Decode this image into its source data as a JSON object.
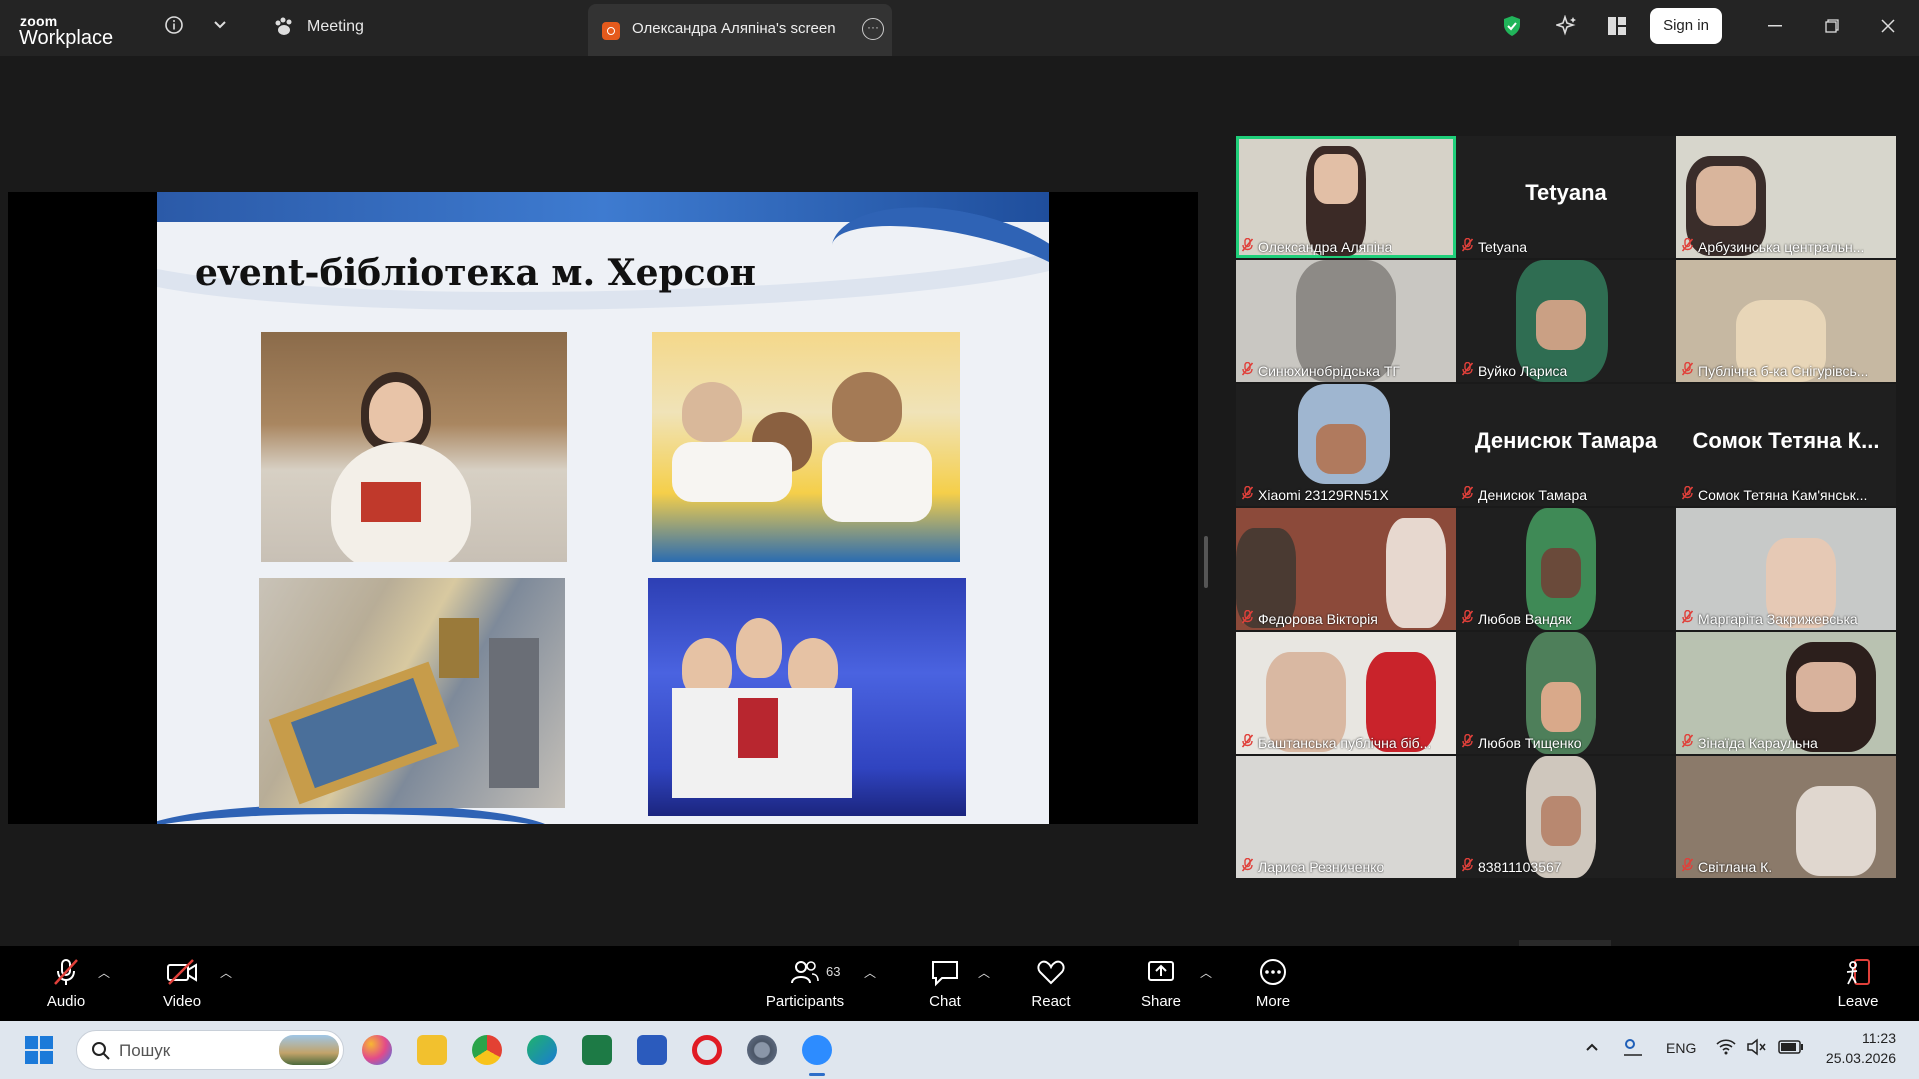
{
  "titlebar": {
    "logo_top": "zoom",
    "logo_bottom": "Workplace",
    "meeting_label": "Meeting",
    "screen_tab": "Олександра Аляпіна's screen",
    "sign_in": "Sign in"
  },
  "slide": {
    "title": "event-бібліотека м. Херсон"
  },
  "gallery": [
    {
      "name": "Олександра Аляпіна",
      "big": ""
    },
    {
      "name": "Tetyana",
      "big": "Tetyana"
    },
    {
      "name": "Арбузинська центральн...",
      "big": ""
    },
    {
      "name": "Синюхинобрідська ТГ",
      "big": ""
    },
    {
      "name": "Вуйко Лариса",
      "big": ""
    },
    {
      "name": "Публічна б-ка Снігурівсь...",
      "big": ""
    },
    {
      "name": "Xiaomi 23129RN51X",
      "big": ""
    },
    {
      "name": "Денисюк Тамара",
      "big": "Денисюк Тамара"
    },
    {
      "name": "Сомок Тетяна Кам'янськ...",
      "big": "Сомок Тетяна К..."
    },
    {
      "name": "Федорова Вікторія",
      "big": ""
    },
    {
      "name": "Любов Вандяк",
      "big": ""
    },
    {
      "name": "Маргаріта Закрижевська",
      "big": ""
    },
    {
      "name": "Баштанська публічна біб...",
      "big": ""
    },
    {
      "name": "Любов Тищенко",
      "big": ""
    },
    {
      "name": "Зінаїда Караульна",
      "big": ""
    },
    {
      "name": "Лариса Резниченко",
      "big": ""
    },
    {
      "name": "83811103567",
      "big": ""
    },
    {
      "name": "Світлана К.",
      "big": ""
    }
  ],
  "toolbar": {
    "audio": "Audio",
    "video": "Video",
    "participants": "Participants",
    "participants_count": "63",
    "chat": "Chat",
    "react": "React",
    "share": "Share",
    "more": "More",
    "leave": "Leave"
  },
  "taskbar": {
    "search_placeholder": "Пошук",
    "lang": "ENG",
    "time": "11:23",
    "date": "25.03.2026"
  },
  "colors": {
    "active_speaker": "#1fcf7a",
    "mic_muted": "#e0403a",
    "leave": "#e0403a"
  }
}
